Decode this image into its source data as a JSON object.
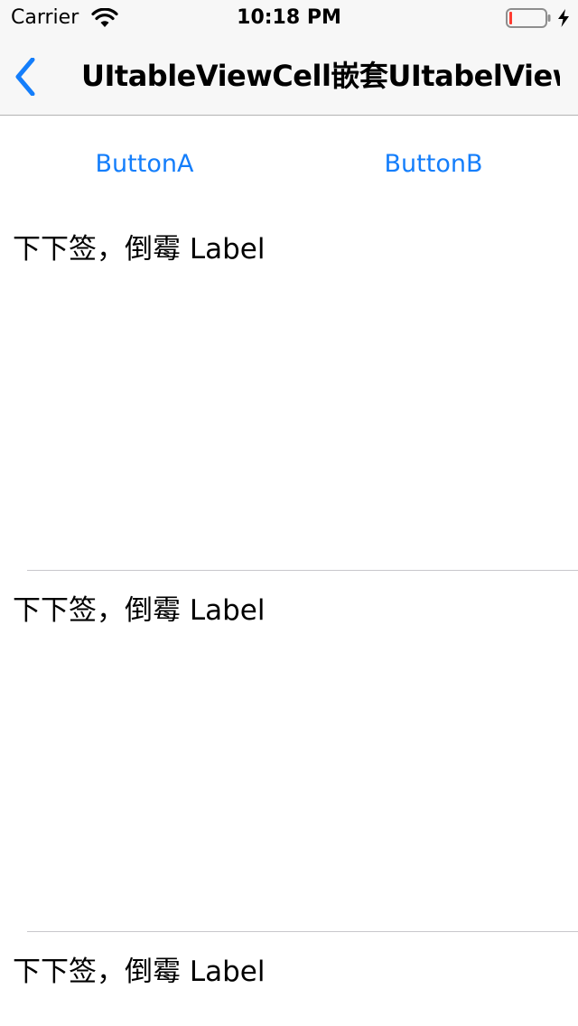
{
  "status_bar": {
    "carrier": "Carrier",
    "time": "10:18 PM"
  },
  "nav": {
    "title": "UItableViewCell嵌套UItabelView",
    "back_icon": "chevron-left-icon",
    "accent_color": "#147efb"
  },
  "buttons": {
    "button_a": "ButtonA",
    "button_b": "ButtonB"
  },
  "cells": [
    {
      "label": "下下签，倒霉 Label"
    },
    {
      "label": "下下签，倒霉 Label"
    },
    {
      "label": "下下签，倒霉 Label"
    }
  ]
}
